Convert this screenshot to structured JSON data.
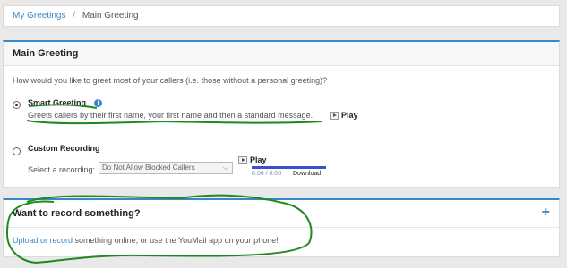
{
  "breadcrumb": {
    "link": "My Greetings",
    "separator": "/",
    "current": "Main Greeting"
  },
  "main_panel": {
    "title": "Main Greeting",
    "question": "How would you like to greet most of your callers (i.e. those without a personal greeting)?",
    "options": {
      "smart": {
        "label": "Smart Greeting",
        "selected": true,
        "description": "Greets callers by their first name, your first name and then a standard message.",
        "play_label": "Play"
      },
      "custom": {
        "label": "Custom Recording",
        "selected": false,
        "select_label": "Select a recording:",
        "select_value": "Do Not Allow Blocked Callers",
        "play_label": "Play",
        "progress": 1.0,
        "time": "0:06 / 0:06",
        "download_label": "Download"
      }
    }
  },
  "record_panel": {
    "title": "Want to record something?",
    "expand_icon": "plus-icon",
    "link_text": "Upload or record",
    "rest_text": " something online, or use the YouMail app on your phone!"
  },
  "colors": {
    "accent": "#3a87c8",
    "annotation": "#1e8a1e",
    "progress": "#3b4fd0"
  }
}
